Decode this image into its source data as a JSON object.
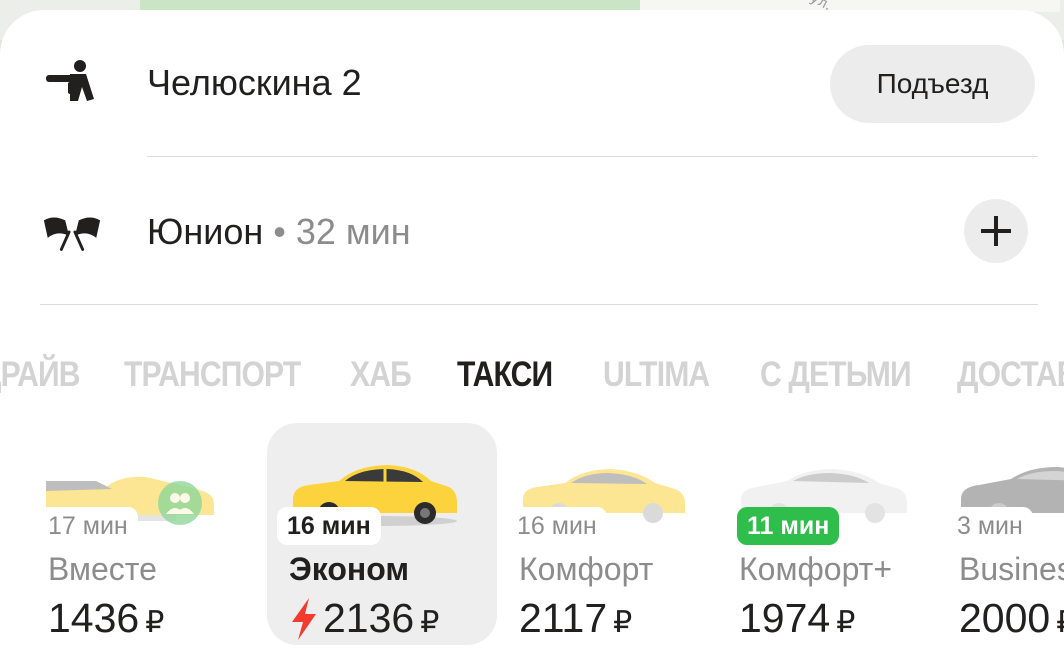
{
  "route": {
    "from": {
      "address": "Челюскина 2",
      "entrance_label": "Подъезд"
    },
    "to": {
      "destination": "Юнион",
      "separator": " • ",
      "duration": "32 мин"
    }
  },
  "tabs": [
    {
      "label": "ДРАЙВ",
      "active": false
    },
    {
      "label": "ТРАНСПОРТ",
      "active": false
    },
    {
      "label": "ХАБ",
      "active": false
    },
    {
      "label": "ТАКСИ",
      "active": true
    },
    {
      "label": "ULTIMA",
      "active": false
    },
    {
      "label": "С ДЕТЬМИ",
      "active": false
    },
    {
      "label": "ДОСТАВКА",
      "active": false
    }
  ],
  "tariffs": [
    {
      "eta": "17 мин",
      "name": "Вместе",
      "price": "1436",
      "currency": "₽",
      "selected": false
    },
    {
      "eta": "16 мин",
      "name": "Эконом",
      "price": "2136",
      "currency": "₽",
      "selected": true,
      "surge": true
    },
    {
      "eta": "16 мин",
      "name": "Комфорт",
      "price": "2117",
      "currency": "₽",
      "selected": false
    },
    {
      "eta": "11 мин",
      "name": "Комфорт+",
      "price": "1974",
      "currency": "₽",
      "selected": false,
      "eta_highlight": "green"
    },
    {
      "eta": "3 мин",
      "name": "Business",
      "price": "2000",
      "currency": "₽",
      "selected": false
    }
  ],
  "colors": {
    "accent_green": "#2fbd4b",
    "surge_red": "#f23a2f",
    "taxi_yellow": "#fcd33c"
  },
  "icons": {
    "from": "person-pointing-icon",
    "to": "finish-flags-icon",
    "add": "plus-icon",
    "together": "group-icon",
    "surge": "lightning-icon"
  },
  "map": {
    "street_fragment": "ул."
  }
}
